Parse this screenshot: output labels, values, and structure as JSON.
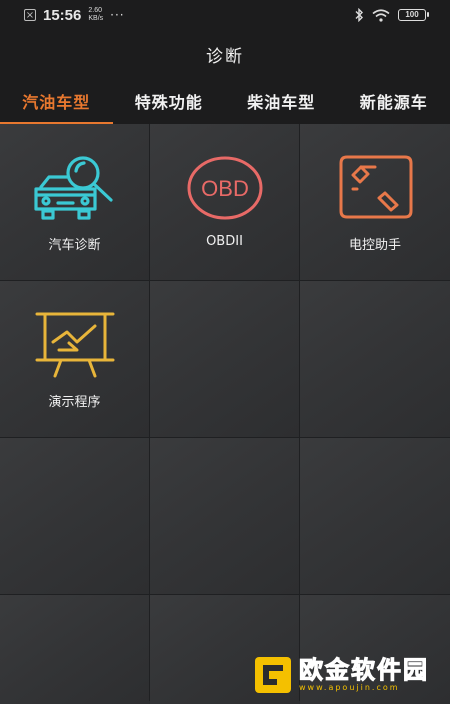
{
  "status_bar": {
    "time": "15:56",
    "net_speed_value": "2.60",
    "net_speed_unit": "KB/s",
    "more": "···",
    "battery": "100"
  },
  "app_bar": {
    "title": "诊断"
  },
  "tabs": [
    {
      "label": "汽油车型",
      "active": true
    },
    {
      "label": "特殊功能",
      "active": false
    },
    {
      "label": "柴油车型",
      "active": false
    },
    {
      "label": "新能源车",
      "active": false
    }
  ],
  "grid": {
    "items": [
      {
        "label": "汽车诊断",
        "icon": "car-search-icon",
        "color": "#3bc9d4"
      },
      {
        "label": "OBDII",
        "icon": "obd-icon",
        "icon_text": "OBD",
        "color": "#e86a67"
      },
      {
        "label": "电控助手",
        "icon": "ecu-assistant-icon",
        "color": "#e8784a"
      },
      {
        "label": "演示程序",
        "icon": "demo-board-icon",
        "color": "#e8b53a"
      }
    ]
  },
  "watermark": {
    "title": "欧金软件园",
    "url": "www.apoujin.com",
    "color": "#f4c000"
  },
  "colors": {
    "accent": "#e8782f",
    "bar_bg": "#1c1c1d",
    "grid_bg": "#333436"
  }
}
